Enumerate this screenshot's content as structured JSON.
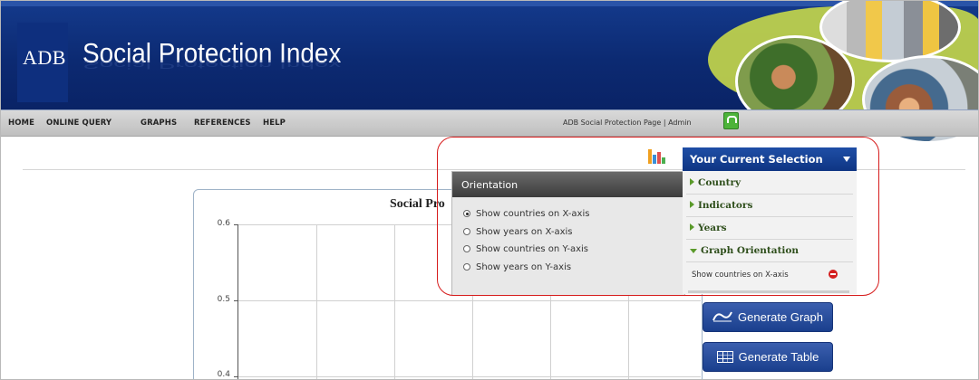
{
  "header": {
    "logo_text": "ADB",
    "title": "Social Protection Index"
  },
  "nav": {
    "items": [
      "HOME",
      "ONLINE QUERY",
      "GRAPHS",
      "REFERENCES",
      "HELP"
    ],
    "right_text": "ADB Social Protection Page | Admin"
  },
  "chart": {
    "title": "Social Pro",
    "y_labels": [
      "0.6",
      "0.5",
      "0.4"
    ]
  },
  "orientation": {
    "title": "Orientation",
    "options": [
      {
        "label": "Show countries on X-axis",
        "checked": true
      },
      {
        "label": "Show years on X-axis",
        "checked": false
      },
      {
        "label": "Show countries on Y-axis",
        "checked": false
      },
      {
        "label": "Show years on Y-axis",
        "checked": false
      }
    ]
  },
  "selection": {
    "title": "Your Current Selection",
    "items": [
      "Country",
      "Indicators",
      "Years",
      "Graph Orientation"
    ],
    "orientation_value": "Show countries on X-axis"
  },
  "buttons": {
    "generate_graph": "Generate Graph",
    "generate_table": "Generate Table"
  },
  "colors": {
    "banner": "#0c2a72",
    "selection_header": "#1a45a0",
    "highlight": "#d61c1c"
  }
}
